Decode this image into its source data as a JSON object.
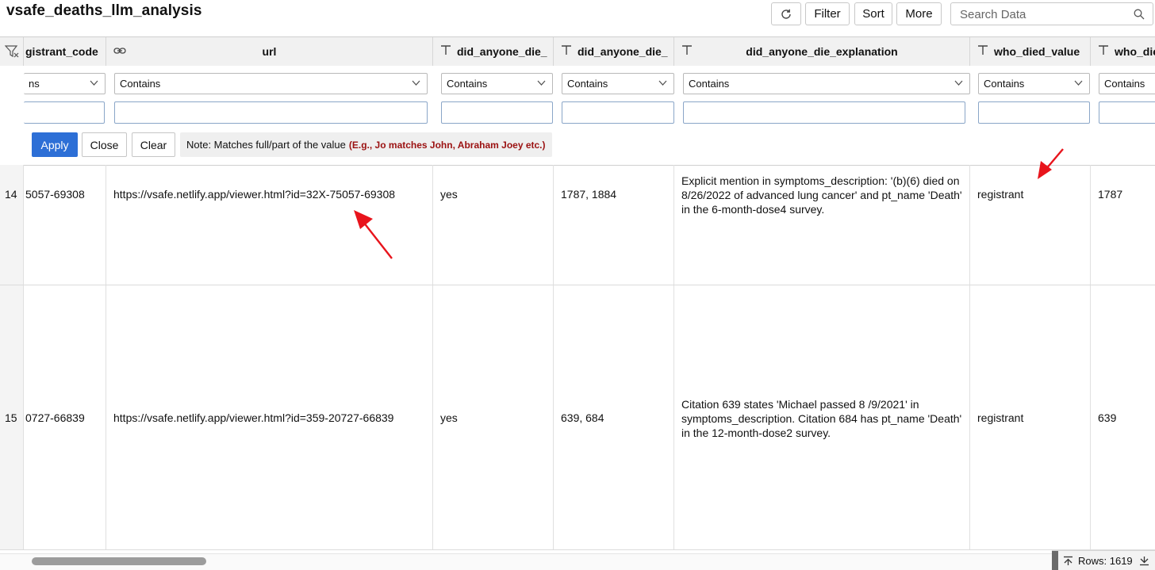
{
  "app": {
    "title": "vsafe_deaths_llm_analysis"
  },
  "toolbar": {
    "refresh_icon": "refresh-icon",
    "filter_label": "Filter",
    "sort_label": "Sort",
    "more_label": "More",
    "search_placeholder": "Search Data"
  },
  "grid": {
    "columns": [
      {
        "key": "registrant_code",
        "label": "gistrant_code",
        "type": "text"
      },
      {
        "key": "url",
        "label": "url",
        "type": "link"
      },
      {
        "key": "did_anyone_die_1",
        "label": "did_anyone_die_",
        "type": "text"
      },
      {
        "key": "did_anyone_die_2",
        "label": "did_anyone_die_",
        "type": "text"
      },
      {
        "key": "did_anyone_die_explanation",
        "label": "did_anyone_die_explanation",
        "type": "text"
      },
      {
        "key": "who_died_value",
        "label": "who_died_value",
        "type": "text"
      },
      {
        "key": "who_died",
        "label": "who_die",
        "type": "text"
      }
    ],
    "filter": {
      "operator_first": "ns",
      "operator": "Contains",
      "apply_label": "Apply",
      "close_label": "Close",
      "clear_label": "Clear",
      "note_label": "Note: Matches full/part of the value",
      "note_example": "(E.g., Jo matches John, Abraham Joey etc.)"
    },
    "rows": [
      {
        "num": "14",
        "registrant_code": "5057-69308",
        "url": "https://vsafe.netlify.app/viewer.html?id=32X-75057-69308",
        "did_anyone_die_1": "yes",
        "did_anyone_die_2": "1787, 1884",
        "explanation": "Explicit mention in symptoms_description: '(b)(6) died on 8/26/2022 of advanced lung cancer' and pt_name 'Death' in the 6-month-dose4 survey.",
        "who_died_value": "registrant",
        "who_died": "1787"
      },
      {
        "num": "15",
        "registrant_code": "0727-66839",
        "url": "https://vsafe.netlify.app/viewer.html?id=359-20727-66839",
        "did_anyone_die_1": "yes",
        "did_anyone_die_2": "639, 684",
        "explanation": "Citation 639 states 'Michael passed 8 /9/2021' in symptoms_description. Citation 684 has pt_name 'Death' in the 12-month-dose2 survey.",
        "who_died_value": "registrant",
        "who_died": "639"
      }
    ]
  },
  "footer": {
    "rows_label": "Rows: 1619"
  },
  "colors": {
    "accent": "#2d6fd6",
    "annotation_arrow": "#e8141c",
    "note_example": "#9b1111"
  }
}
